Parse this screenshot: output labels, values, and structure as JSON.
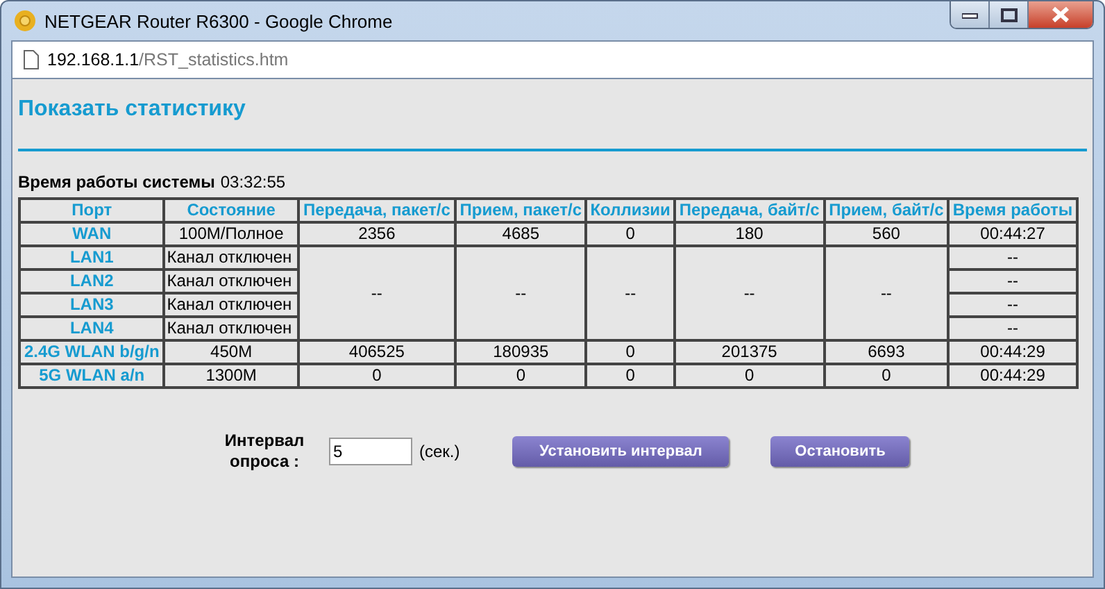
{
  "window": {
    "title": "NETGEAR Router R6300 - Google Chrome"
  },
  "address": {
    "host": "192.168.1.1",
    "path": "/RST_statistics.htm"
  },
  "page": {
    "heading": "Показать статистику",
    "uptime_label": "Время работы системы",
    "uptime_value": "03:32:55"
  },
  "table": {
    "columns": [
      "Порт",
      "Состояние",
      "Передача, пакет/с",
      "Прием, пакет/с",
      "Коллизии",
      "Передача, байт/с",
      "Прием, байт/с",
      "Время работы"
    ],
    "rows": [
      {
        "kind": "full",
        "port": "WAN",
        "status": "100M/Полное",
        "values": [
          "2356",
          "4685",
          "0",
          "180",
          "560"
        ],
        "uptime": "00:44:27"
      },
      {
        "kind": "shared",
        "port": "LAN1",
        "status": "Канал отключен",
        "uptime": "--"
      },
      {
        "kind": "shared",
        "port": "LAN2",
        "status": "Канал отключен",
        "uptime": "--"
      },
      {
        "kind": "shared",
        "port": "LAN3",
        "status": "Канал отключен",
        "uptime": "--"
      },
      {
        "kind": "shared",
        "port": "LAN4",
        "status": "Канал отключен",
        "uptime": "--"
      },
      {
        "kind": "full",
        "port": "2.4G WLAN b/g/n",
        "status": "450M",
        "values": [
          "406525",
          "180935",
          "0",
          "201375",
          "6693"
        ],
        "uptime": "00:44:29"
      },
      {
        "kind": "full",
        "port": "5G WLAN a/n",
        "status": "1300M",
        "values": [
          "0",
          "0",
          "0",
          "0",
          "0"
        ],
        "uptime": "00:44:29"
      }
    ],
    "shared_values": [
      "--",
      "--",
      "--",
      "--",
      "--"
    ]
  },
  "poll": {
    "label": "Интервал опроса :",
    "value": "5",
    "unit": "(сек.)",
    "buttons": [
      "Установить интервал",
      "Остановить"
    ]
  }
}
